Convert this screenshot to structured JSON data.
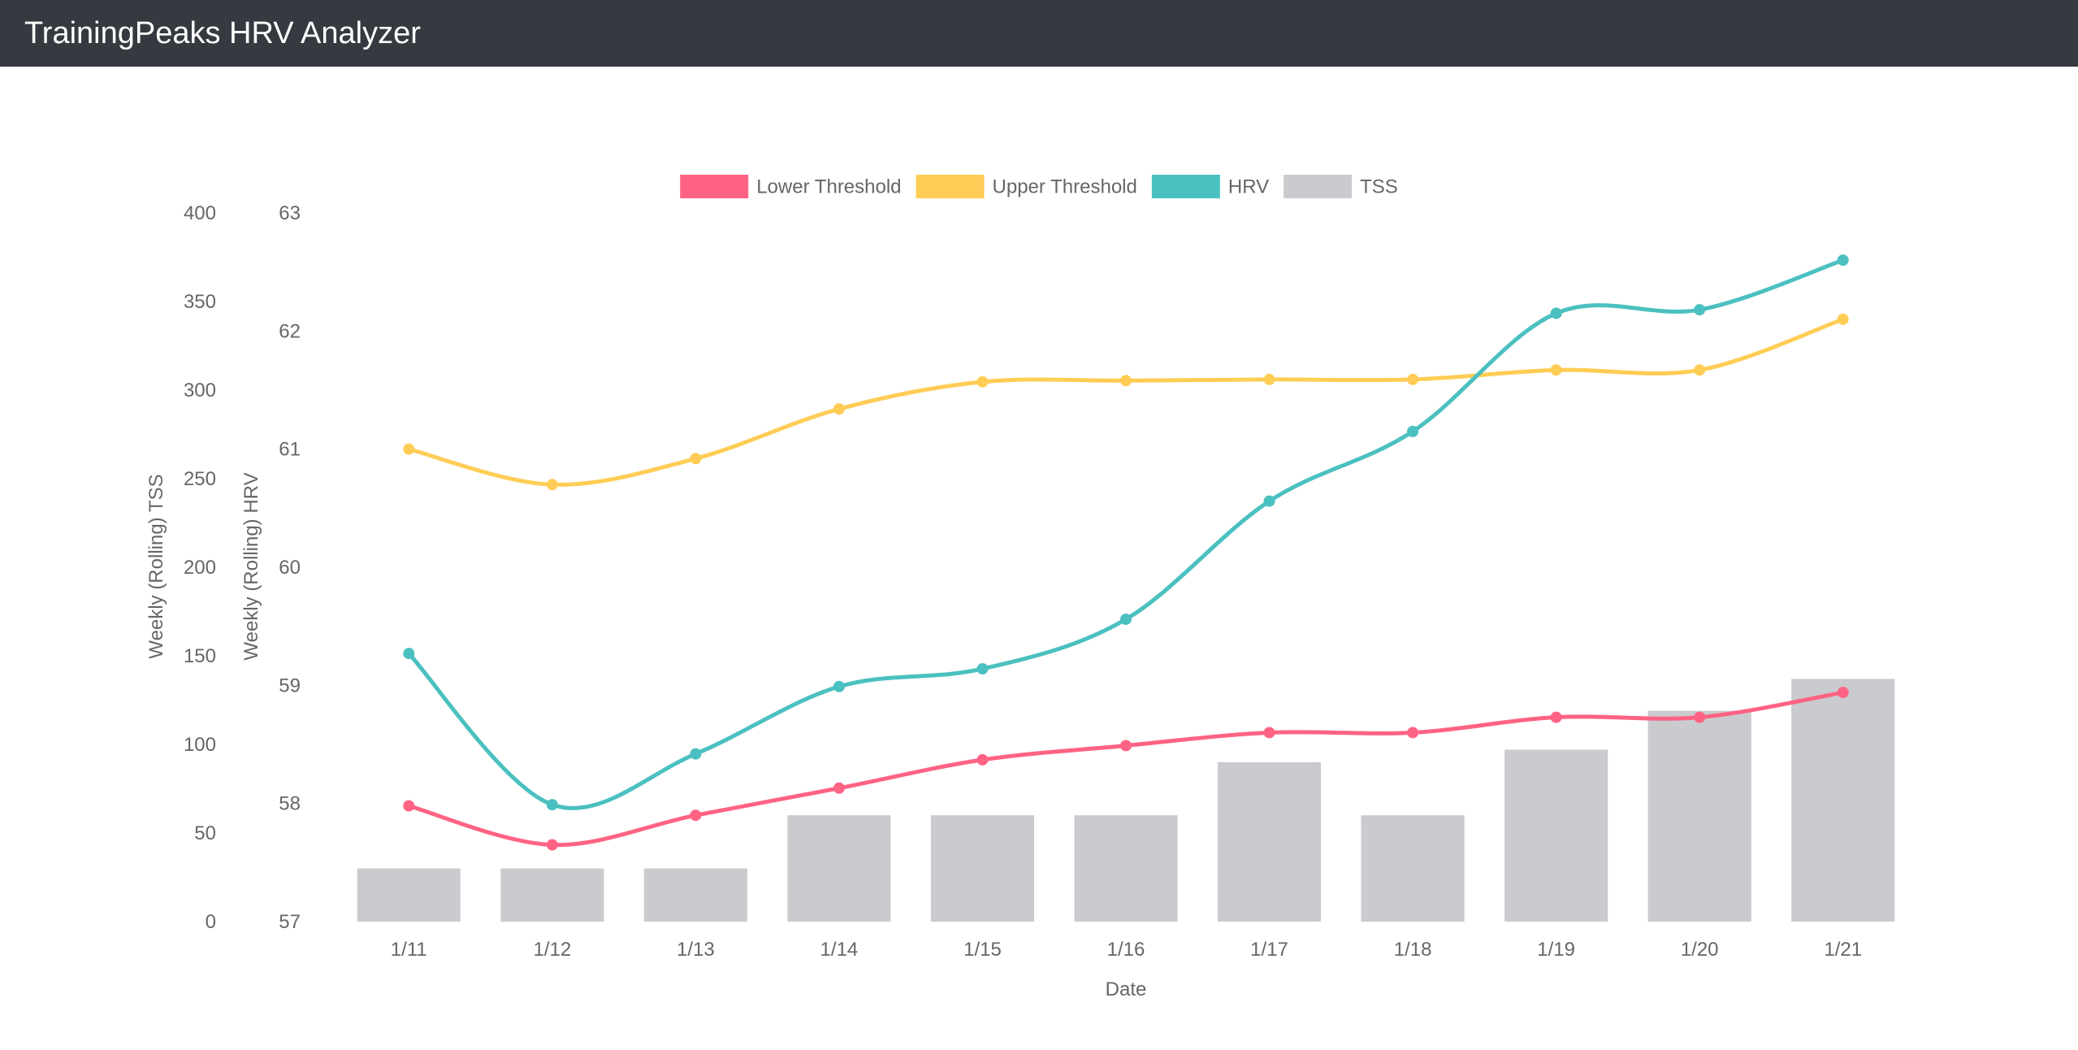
{
  "header": {
    "title": "TrainingPeaks HRV Analyzer"
  },
  "colors": {
    "header_bg": "#343a40",
    "lower_threshold": "#ff6384",
    "upper_threshold": "#ffcd56",
    "hrv": "#4bc0c0",
    "tss": "#c9cbcf",
    "grid": "none"
  },
  "chart_data": {
    "type": "bar",
    "grid": false,
    "legend_placement": "top-center",
    "xlabel": "Date",
    "ylabel_left_outer": "Weekly (Rolling) TSS",
    "ylabel_left_inner": "Weekly (Rolling) HRV",
    "categories": [
      "1/11",
      "1/12",
      "1/13",
      "1/14",
      "1/15",
      "1/16",
      "1/17",
      "1/18",
      "1/19",
      "1/20",
      "1/21"
    ],
    "axes": {
      "tss": {
        "min": 0,
        "max": 400,
        "ticks": [
          "0",
          "50",
          "100",
          "150",
          "200",
          "250",
          "300",
          "350",
          "400"
        ]
      },
      "hrv": {
        "min": 57,
        "max": 63,
        "ticks": [
          "57",
          "58",
          "59",
          "60",
          "61",
          "62",
          "63"
        ]
      }
    },
    "series": [
      {
        "name": "Lower Threshold",
        "type": "line",
        "axis": "hrv",
        "color": "#ff6384",
        "values": [
          57.98,
          57.65,
          57.9,
          58.13,
          58.37,
          58.49,
          58.6,
          58.6,
          58.73,
          58.73,
          58.94
        ]
      },
      {
        "name": "Upper Threshold",
        "type": "line",
        "axis": "hrv",
        "color": "#ffcd56",
        "values": [
          61.0,
          60.7,
          60.92,
          61.34,
          61.57,
          61.58,
          61.59,
          61.59,
          61.67,
          61.67,
          62.1
        ]
      },
      {
        "name": "HRV",
        "type": "line",
        "axis": "hrv",
        "color": "#4bc0c0",
        "values": [
          59.27,
          57.99,
          58.42,
          58.99,
          59.14,
          59.56,
          60.56,
          61.15,
          62.15,
          62.18,
          62.6
        ]
      },
      {
        "name": "TSS",
        "type": "bar",
        "axis": "tss",
        "color": "#c9cbcf",
        "values": [
          30,
          30,
          30,
          60,
          60,
          60,
          90,
          60,
          97,
          119,
          137
        ]
      }
    ]
  }
}
